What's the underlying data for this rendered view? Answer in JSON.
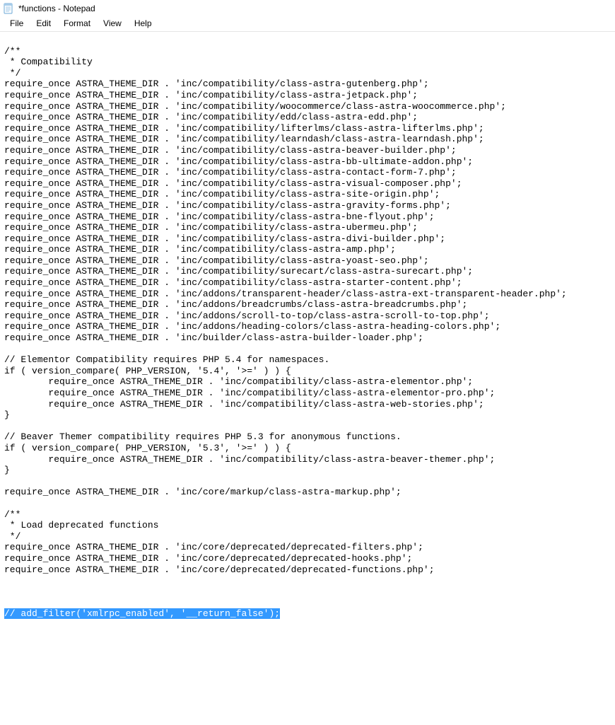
{
  "window": {
    "title": "*functions - Notepad"
  },
  "menu": {
    "file": "File",
    "edit": "Edit",
    "format": "Format",
    "view": "View",
    "help": "Help"
  },
  "code": {
    "line01": "/**",
    "line02": " * Compatibility",
    "line03": " */",
    "line04": "require_once ASTRA_THEME_DIR . 'inc/compatibility/class-astra-gutenberg.php';",
    "line05": "require_once ASTRA_THEME_DIR . 'inc/compatibility/class-astra-jetpack.php';",
    "line06": "require_once ASTRA_THEME_DIR . 'inc/compatibility/woocommerce/class-astra-woocommerce.php';",
    "line07": "require_once ASTRA_THEME_DIR . 'inc/compatibility/edd/class-astra-edd.php';",
    "line08": "require_once ASTRA_THEME_DIR . 'inc/compatibility/lifterlms/class-astra-lifterlms.php';",
    "line09": "require_once ASTRA_THEME_DIR . 'inc/compatibility/learndash/class-astra-learndash.php';",
    "line10": "require_once ASTRA_THEME_DIR . 'inc/compatibility/class-astra-beaver-builder.php';",
    "line11": "require_once ASTRA_THEME_DIR . 'inc/compatibility/class-astra-bb-ultimate-addon.php';",
    "line12": "require_once ASTRA_THEME_DIR . 'inc/compatibility/class-astra-contact-form-7.php';",
    "line13": "require_once ASTRA_THEME_DIR . 'inc/compatibility/class-astra-visual-composer.php';",
    "line14": "require_once ASTRA_THEME_DIR . 'inc/compatibility/class-astra-site-origin.php';",
    "line15": "require_once ASTRA_THEME_DIR . 'inc/compatibility/class-astra-gravity-forms.php';",
    "line16": "require_once ASTRA_THEME_DIR . 'inc/compatibility/class-astra-bne-flyout.php';",
    "line17": "require_once ASTRA_THEME_DIR . 'inc/compatibility/class-astra-ubermeu.php';",
    "line18": "require_once ASTRA_THEME_DIR . 'inc/compatibility/class-astra-divi-builder.php';",
    "line19": "require_once ASTRA_THEME_DIR . 'inc/compatibility/class-astra-amp.php';",
    "line20": "require_once ASTRA_THEME_DIR . 'inc/compatibility/class-astra-yoast-seo.php';",
    "line21": "require_once ASTRA_THEME_DIR . 'inc/compatibility/surecart/class-astra-surecart.php';",
    "line22": "require_once ASTRA_THEME_DIR . 'inc/compatibility/class-astra-starter-content.php';",
    "line23": "require_once ASTRA_THEME_DIR . 'inc/addons/transparent-header/class-astra-ext-transparent-header.php';",
    "line24": "require_once ASTRA_THEME_DIR . 'inc/addons/breadcrumbs/class-astra-breadcrumbs.php';",
    "line25": "require_once ASTRA_THEME_DIR . 'inc/addons/scroll-to-top/class-astra-scroll-to-top.php';",
    "line26": "require_once ASTRA_THEME_DIR . 'inc/addons/heading-colors/class-astra-heading-colors.php';",
    "line27": "require_once ASTRA_THEME_DIR . 'inc/builder/class-astra-builder-loader.php';",
    "line28": "",
    "line29": "// Elementor Compatibility requires PHP 5.4 for namespaces.",
    "line30": "if ( version_compare( PHP_VERSION, '5.4', '>=' ) ) {",
    "line31": "        require_once ASTRA_THEME_DIR . 'inc/compatibility/class-astra-elementor.php';",
    "line32": "        require_once ASTRA_THEME_DIR . 'inc/compatibility/class-astra-elementor-pro.php';",
    "line33": "        require_once ASTRA_THEME_DIR . 'inc/compatibility/class-astra-web-stories.php';",
    "line34": "}",
    "line35": "",
    "line36": "// Beaver Themer compatibility requires PHP 5.3 for anonymous functions.",
    "line37": "if ( version_compare( PHP_VERSION, '5.3', '>=' ) ) {",
    "line38": "        require_once ASTRA_THEME_DIR . 'inc/compatibility/class-astra-beaver-themer.php';",
    "line39": "}",
    "line40": "",
    "line41": "require_once ASTRA_THEME_DIR . 'inc/core/markup/class-astra-markup.php';",
    "line42": "",
    "line43": "/**",
    "line44": " * Load deprecated functions",
    "line45": " */",
    "line46": "require_once ASTRA_THEME_DIR . 'inc/core/deprecated/deprecated-filters.php';",
    "line47": "require_once ASTRA_THEME_DIR . 'inc/core/deprecated/deprecated-hooks.php';",
    "line48": "require_once ASTRA_THEME_DIR . 'inc/core/deprecated/deprecated-functions.php';",
    "line49": "",
    "line50": "",
    "line51": "",
    "selected": "// add_filter('xmlrpc_enabled', '__return_false');"
  }
}
